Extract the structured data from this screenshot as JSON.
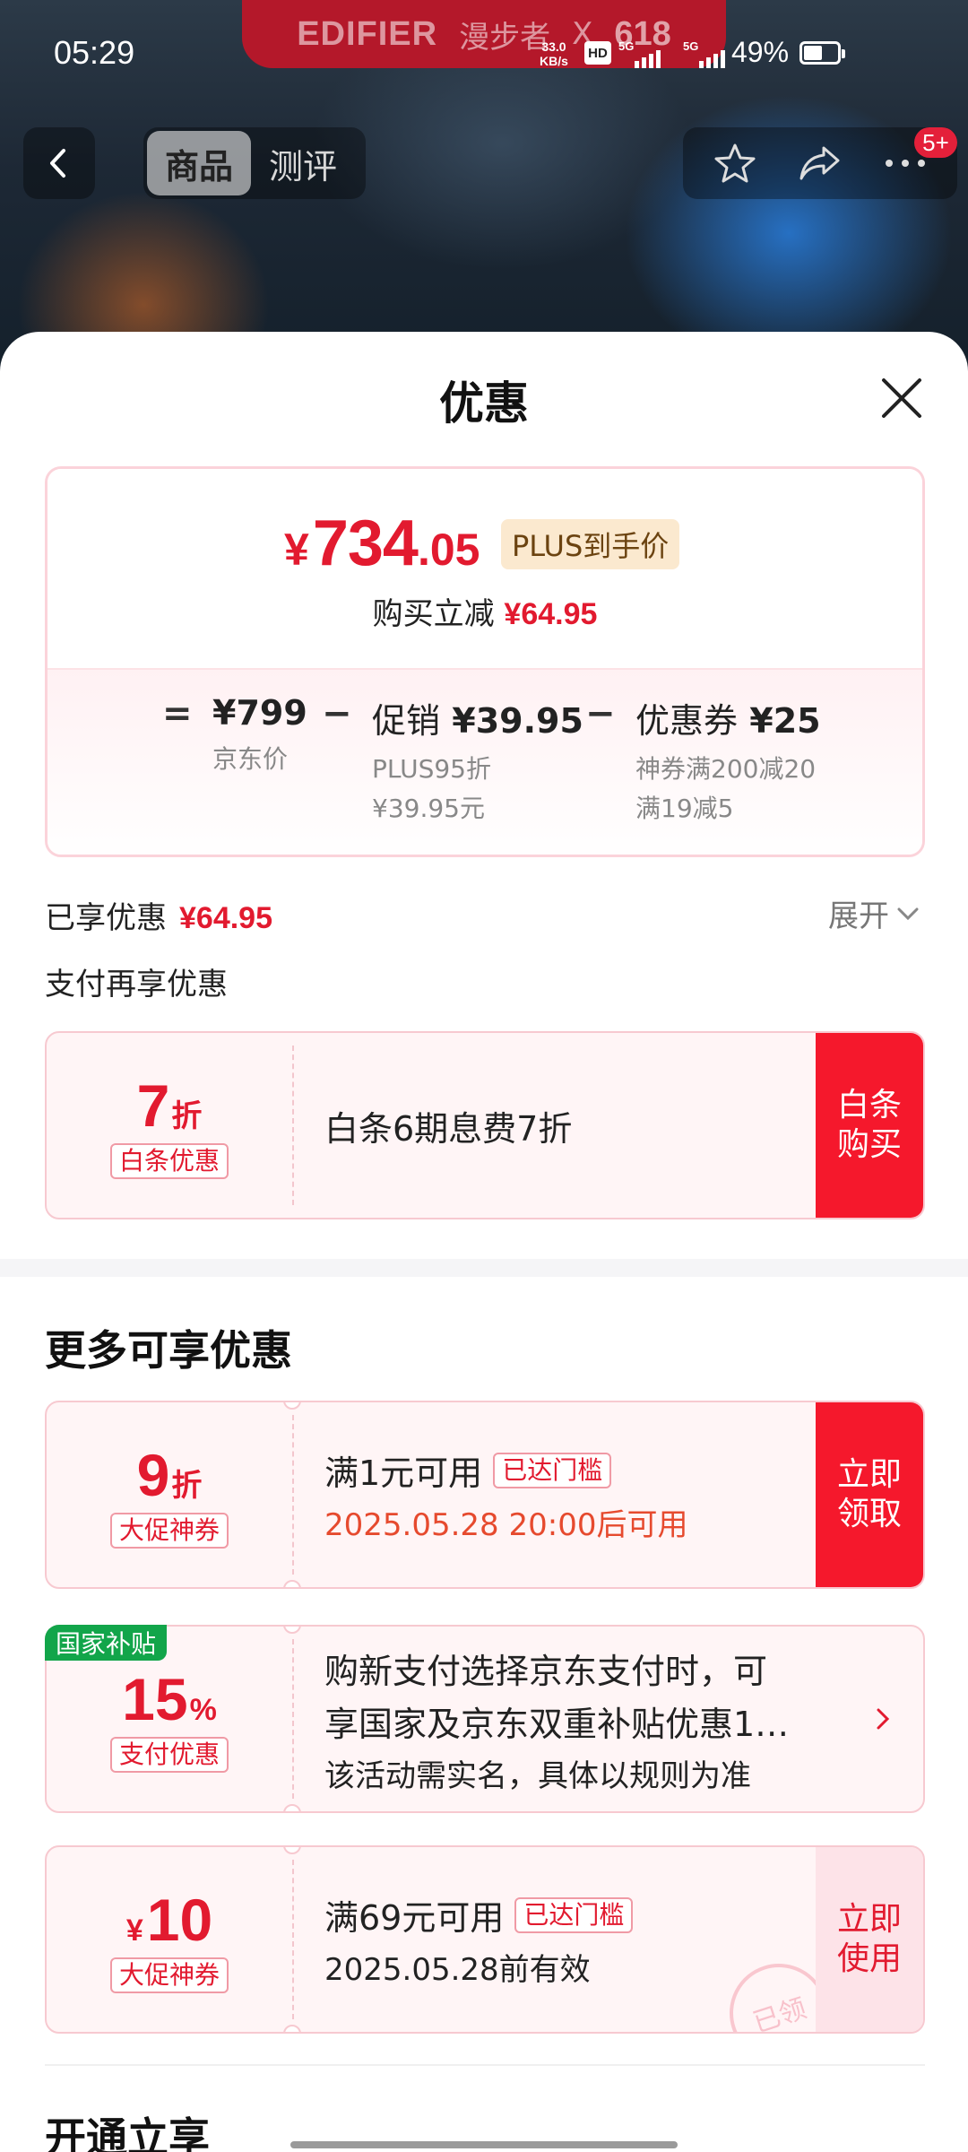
{
  "status": {
    "time": "05:29",
    "net_speed_top": "33.0",
    "net_speed_unit": "KB/s",
    "hd": "HD",
    "sim1": "5G",
    "sim2": "5G",
    "battery_pct": "49%"
  },
  "banner": {
    "brand": "EDIFIER",
    "brand_cn": "漫步者",
    "cross": "X",
    "event": "618"
  },
  "nav": {
    "tabs": [
      {
        "label": "商品"
      },
      {
        "label": "测评"
      }
    ],
    "badge": "5+"
  },
  "sheet": {
    "title": "优惠",
    "price": {
      "currency": "¥",
      "integer": "734",
      "decimal": ".05",
      "plus_tag": "PLUS到手价"
    },
    "reduce": {
      "label": "购买立减",
      "amount": "¥64.95"
    },
    "formula": {
      "eq": "=",
      "minus": "−",
      "jd_price": "¥799",
      "jd_label": "京东价",
      "promo_label": "促销",
      "promo_value": "¥39.95",
      "promo_sub1": "PLUS95折",
      "promo_sub2": "¥39.95元",
      "coupon_label": "优惠券",
      "coupon_value": "¥25",
      "coupon_sub1": "神券满200减20",
      "coupon_sub2": "满19减5"
    },
    "enjoyed": {
      "label": "已享优惠",
      "amount": "¥64.95",
      "expand": "展开"
    },
    "pay_more": "支付再享优惠",
    "baitiao": {
      "value": "7",
      "unit": "折",
      "tag": "白条优惠",
      "desc": "白条6期息费7折",
      "action_line1": "白条",
      "action_line2": "购买"
    },
    "more_title": "更多可享优惠",
    "coupons": [
      {
        "value": "9",
        "unit": "折",
        "tag": "大促神券",
        "line1": "满1元可用",
        "reach": "已达门槛",
        "line2": "2025.05.28 20:00后可用",
        "action_line1": "立即",
        "action_line2": "领取"
      },
      {
        "ribbon": "国家补贴",
        "value": "15",
        "unit": "%",
        "tag": "支付优惠",
        "line1": "购新支付选择京东支付时，可",
        "line1b": "享国家及京东双重补贴优惠1…",
        "line2": "该活动需实名，具体以规则为准"
      },
      {
        "prefix": "¥",
        "value": "10",
        "tag": "大促神券",
        "line1": "满69元可用",
        "reach": "已达门槛",
        "line2": "2025.05.28前有效",
        "action_line1": "立即",
        "action_line2": "使用",
        "stamp": "已领"
      }
    ],
    "open_title": "开通立享"
  },
  "colors": {
    "accent_red": "#e21a2f",
    "action_red": "#f5182c",
    "gov_green": "#12a54a",
    "plus_gold": "#fbe9cf"
  }
}
